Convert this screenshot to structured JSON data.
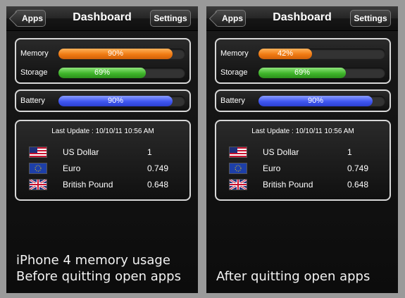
{
  "screens": [
    {
      "nav": {
        "back_label": "Apps",
        "title": "Dashboard",
        "settings_label": "Settings"
      },
      "meters": {
        "memory": {
          "label": "Memory",
          "value_text": "90%",
          "percent": 90,
          "color": "#f07a12"
        },
        "storage": {
          "label": "Storage",
          "value_text": "69%",
          "percent": 69,
          "color": "#3fb52a"
        },
        "battery": {
          "label": "Battery",
          "value_text": "90%",
          "percent": 90,
          "color": "#3f56f0"
        }
      },
      "currency": {
        "last_update": "Last Update : 10/10/11 10:56 AM",
        "rows": [
          {
            "flag": "us-flag-icon",
            "name": "US Dollar",
            "value": "1"
          },
          {
            "flag": "eu-flag-icon",
            "name": "Euro",
            "value": "0.749"
          },
          {
            "flag": "uk-flag-icon",
            "name": "British Pound",
            "value": "0.648"
          }
        ]
      },
      "caption": {
        "line1": "iPhone 4 memory usage",
        "line2": "Before quitting open apps"
      }
    },
    {
      "nav": {
        "back_label": "Apps",
        "title": "Dashboard",
        "settings_label": "Settings"
      },
      "meters": {
        "memory": {
          "label": "Memory",
          "value_text": "42%",
          "percent": 42,
          "color": "#f07a12"
        },
        "storage": {
          "label": "Storage",
          "value_text": "69%",
          "percent": 69,
          "color": "#3fb52a"
        },
        "battery": {
          "label": "Battery",
          "value_text": "90%",
          "percent": 90,
          "color": "#3f56f0"
        }
      },
      "currency": {
        "last_update": "Last Update : 10/10/11 10:56 AM",
        "rows": [
          {
            "flag": "us-flag-icon",
            "name": "US Dollar",
            "value": "1"
          },
          {
            "flag": "eu-flag-icon",
            "name": "Euro",
            "value": "0.749"
          },
          {
            "flag": "uk-flag-icon",
            "name": "British Pound",
            "value": "0.648"
          }
        ]
      },
      "caption": {
        "line1": "After quitting open apps"
      }
    }
  ]
}
